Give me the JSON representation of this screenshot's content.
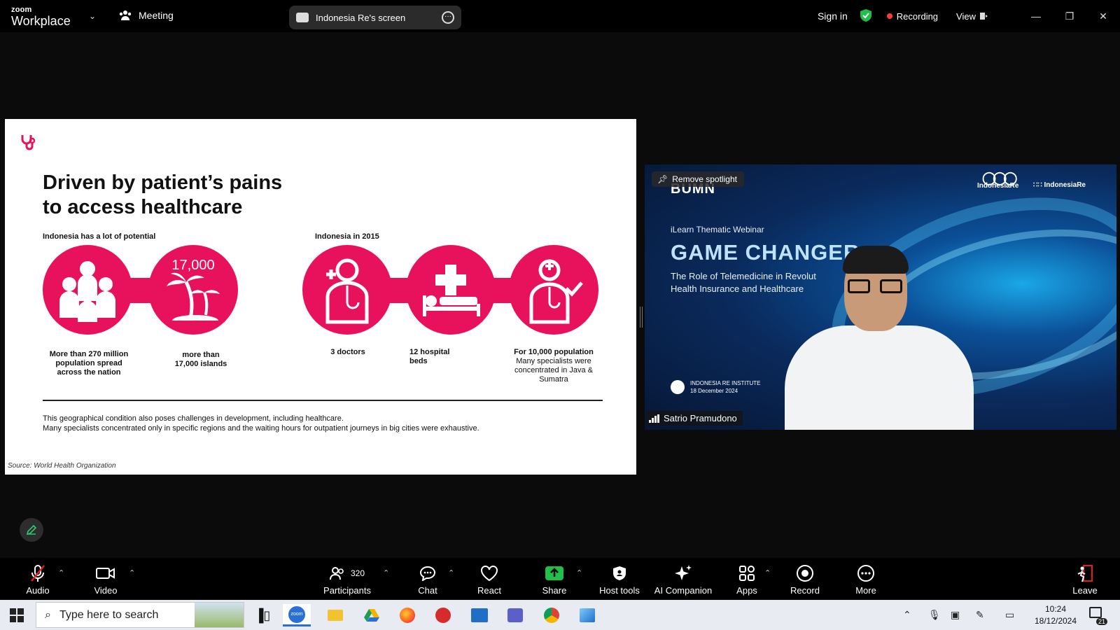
{
  "app": {
    "brand_small": "zoom",
    "brand_big": "Workplace",
    "meeting_label": "Meeting",
    "screen_share_label": "Indonesia Re's screen",
    "sign_in": "Sign in",
    "recording": "Recording",
    "view": "View"
  },
  "slide": {
    "title_line1": "Driven by patient’s pains",
    "title_line2": "to access healthcare",
    "subtitle_left": "Indonesia has a lot of potential",
    "subtitle_right": "Indonesia in 2015",
    "circle_number": "17,000",
    "captions": {
      "population_1": "More than 270 million",
      "population_2": "population  spread",
      "population_3": "across the nation",
      "islands_1": "more than",
      "islands_2": "17,000 islands",
      "doctors": "3 doctors",
      "beds_1": "12 hospital",
      "beds_2": "beds",
      "specialists_head": "For 10,000 population",
      "specialists_1": "Many specialists were",
      "specialists_2": "concentrated in Java &",
      "specialists_3": "Sumatra"
    },
    "footnote_1": "This geographical condition also poses challenges in development, including healthcare.",
    "footnote_2": "Many specialists concentrated only in specific regions and the waiting hours for outpatient journeys in big cities were exhaustive.",
    "source": "Source: World Health Organization",
    "accent_color": "#e8115b"
  },
  "video": {
    "remove_spotlight": "Remove spotlight",
    "bumn": "BUMN",
    "logo_ire": "IndonesiaRe",
    "logo_institute": "IndonesiaRe",
    "webinar": "iLearn Thematic Webinar",
    "headline": "GAME CHANGER",
    "sub_1": "The Role of Telemedicine in Revolut",
    "sub_2": "Health Insurance and Healthcare",
    "institute": "INDONESIA RE INSTITUTE",
    "date": "18 December 2024",
    "speaker": "Satrio Pramudono"
  },
  "toolbar": {
    "audio": "Audio",
    "video": "Video",
    "participants": "Participants",
    "participant_count": "320",
    "chat": "Chat",
    "react": "React",
    "share": "Share",
    "host_tools": "Host tools",
    "ai_companion": "AI Companion",
    "apps": "Apps",
    "record": "Record",
    "more": "More",
    "leave": "Leave"
  },
  "taskbar": {
    "search_placeholder": "Type here to search",
    "time": "10:24",
    "date": "18/12/2024",
    "notifications": "21",
    "zoom_app": "zoom"
  }
}
